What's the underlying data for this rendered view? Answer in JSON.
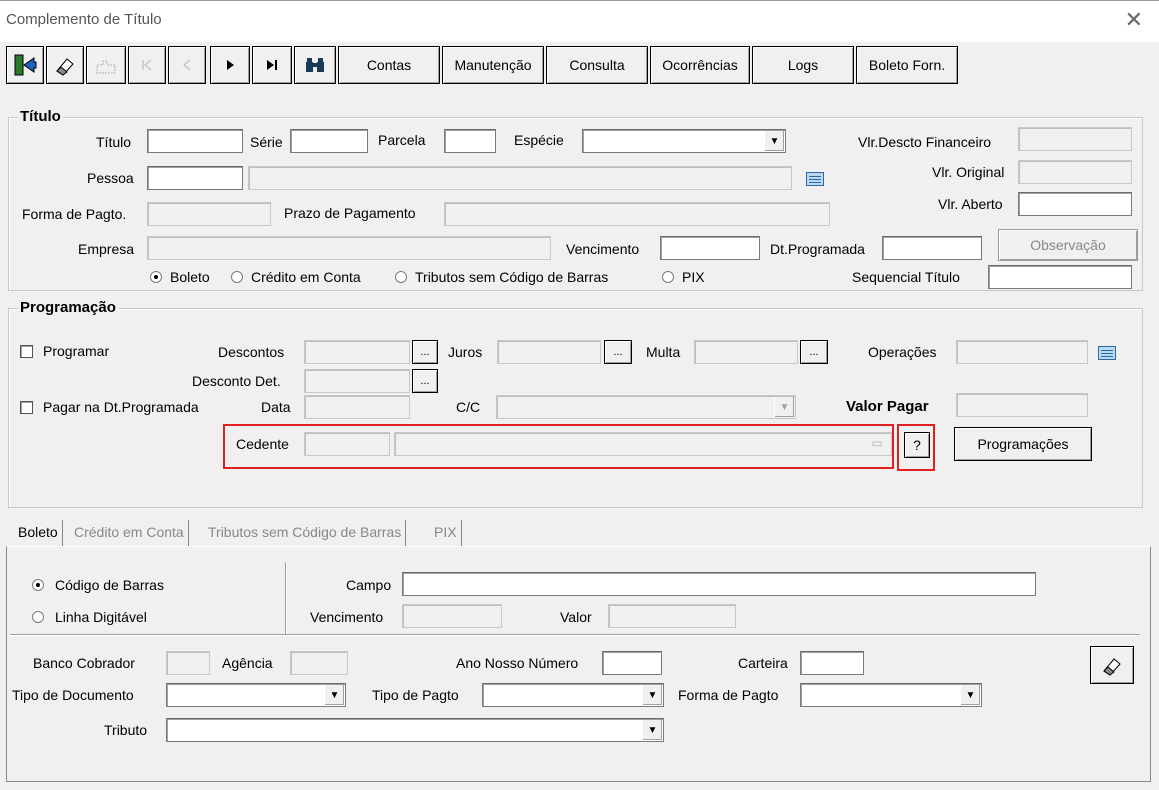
{
  "window": {
    "title": "Complemento de Título",
    "close": "✕"
  },
  "toolbar": {
    "icons": [
      "exit-icon",
      "eraser-icon",
      "jigsaw-icon",
      "first-icon",
      "prev-icon",
      "next-icon",
      "last-icon",
      "binoculars-icon"
    ],
    "contas": "Contas",
    "manutencao": "Manutenção",
    "consulta": "Consulta",
    "ocorrencias": "Ocorrências",
    "logs": "Logs",
    "boleto_forn": "Boleto Forn."
  },
  "titulo": {
    "group": "Título",
    "titulo_lbl": "Título",
    "serie_lbl": "Série",
    "parcela_lbl": "Parcela",
    "especie_lbl": "Espécie",
    "vlr_descto_lbl": "Vlr.Descto Financeiro",
    "pessoa_lbl": "Pessoa",
    "vlr_original_lbl": "Vlr. Original",
    "forma_pagto_lbl": "Forma de Pagto.",
    "prazo_lbl": "Prazo de Pagamento",
    "vlr_aberto_lbl": "Vlr. Aberto",
    "empresa_lbl": "Empresa",
    "vencimento_lbl": "Vencimento",
    "dt_programada_lbl": "Dt.Programada",
    "observacao_btn": "Observação",
    "radio_boleto": "Boleto",
    "radio_credito": "Crédito em Conta",
    "radio_tributos": "Tributos sem Código de Barras",
    "radio_pix": "PIX",
    "sequencial_lbl": "Sequencial Título"
  },
  "programacao": {
    "group": "Programação",
    "programar_lbl": "Programar",
    "descontos_lbl": "Descontos",
    "juros_lbl": "Juros",
    "multa_lbl": "Multa",
    "operacoes_lbl": "Operações",
    "desconto_det_lbl": "Desconto Det.",
    "pagar_dt_lbl": "Pagar na Dt.Programada",
    "data_lbl": "Data",
    "cc_lbl": "C/C",
    "valor_pagar_lbl": "Valor Pagar",
    "cedente_lbl": "Cedente",
    "help_btn": "?",
    "programacoes_btn": "Programações",
    "ellipsis": "..."
  },
  "tabs": [
    "Boleto",
    "Crédito em Conta",
    "Tributos sem Código de Barras",
    "PIX"
  ],
  "boleto": {
    "radio_codigo": "Código de Barras",
    "radio_linha": "Linha Digitável",
    "campo_lbl": "Campo",
    "vencimento_lbl": "Vencimento",
    "valor_lbl": "Valor",
    "banco_lbl": "Banco Cobrador",
    "agencia_lbl": "Agência",
    "ano_nosso_lbl": "Ano Nosso Número",
    "carteira_lbl": "Carteira",
    "tipo_doc_lbl": "Tipo de Documento",
    "tipo_pagto_lbl": "Tipo de Pagto",
    "forma_pagto_lbl": "Forma de Pagto",
    "tributo_lbl": "Tributo"
  },
  "colors": {
    "highlight": "#e02020",
    "background": "#f0f0f0"
  }
}
